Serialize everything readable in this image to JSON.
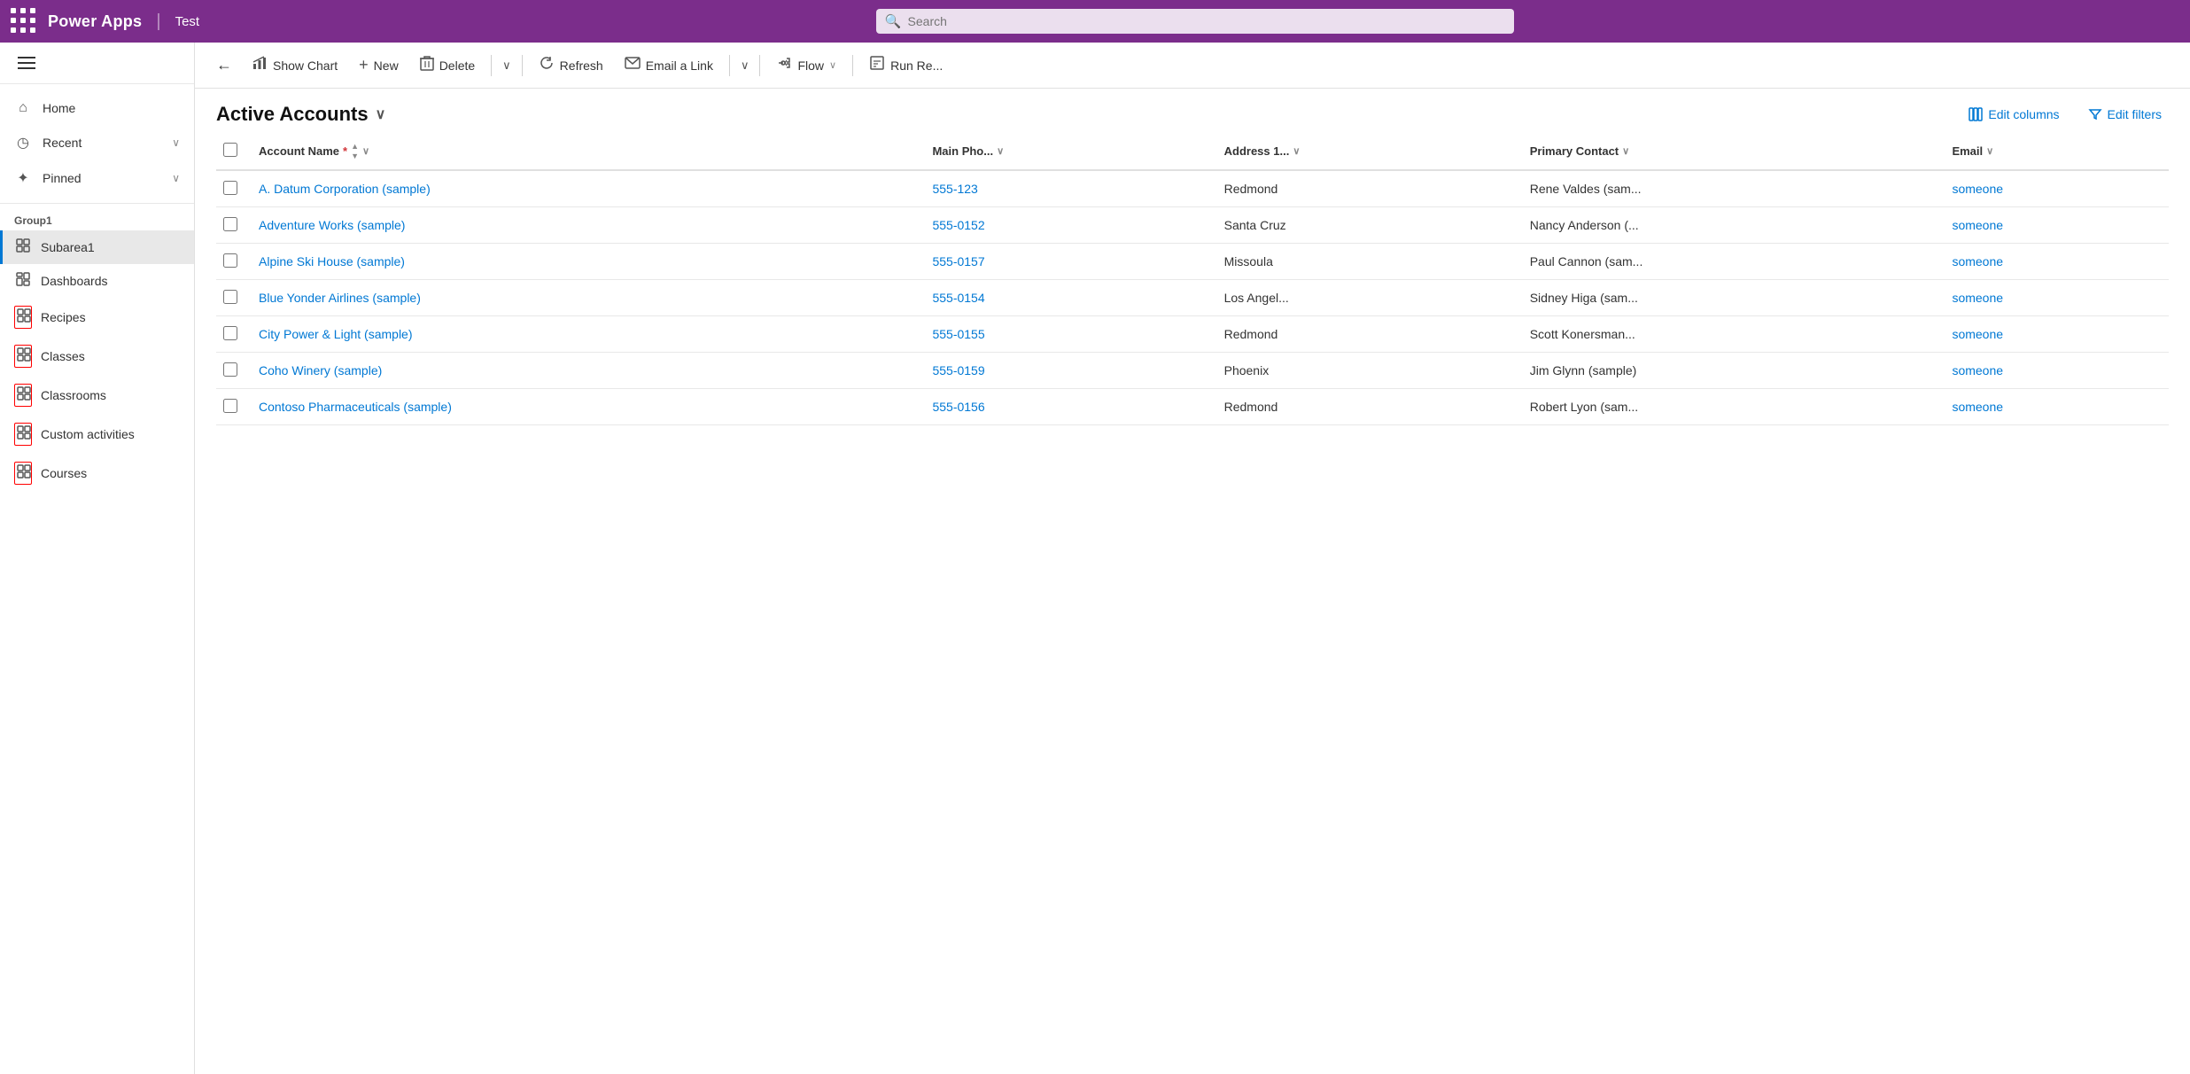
{
  "topnav": {
    "brand": "Power Apps",
    "divider": "|",
    "app": "Test",
    "search_placeholder": "Search"
  },
  "sidebar": {
    "nav_items": [
      {
        "id": "home",
        "label": "Home",
        "icon": "⌂",
        "has_chevron": false
      },
      {
        "id": "recent",
        "label": "Recent",
        "icon": "⊙",
        "has_chevron": true
      },
      {
        "id": "pinned",
        "label": "Pinned",
        "icon": "✦",
        "has_chevron": true
      }
    ],
    "group_label": "Group1",
    "items": [
      {
        "id": "subarea1",
        "label": "Subarea1",
        "icon": "⊞",
        "active": true,
        "outlined": false
      },
      {
        "id": "dashboards",
        "label": "Dashboards",
        "icon": "⊞",
        "active": false,
        "outlined": false
      },
      {
        "id": "recipes",
        "label": "Recipes",
        "icon": "⊞",
        "active": false,
        "outlined": true
      },
      {
        "id": "classes",
        "label": "Classes",
        "icon": "⊞",
        "active": false,
        "outlined": true
      },
      {
        "id": "classrooms",
        "label": "Classrooms",
        "icon": "⊞",
        "active": false,
        "outlined": true
      },
      {
        "id": "custom-activities",
        "label": "Custom activities",
        "icon": "⊞",
        "active": false,
        "outlined": true
      },
      {
        "id": "courses",
        "label": "Courses",
        "icon": "⊞",
        "active": false,
        "outlined": true
      }
    ]
  },
  "toolbar": {
    "back_label": "←",
    "show_chart_label": "Show Chart",
    "new_label": "New",
    "delete_label": "Delete",
    "refresh_label": "Refresh",
    "email_a_link_label": "Email a Link",
    "flow_label": "Flow",
    "run_report_label": "Run Re..."
  },
  "list": {
    "title": "Active Accounts",
    "edit_columns_label": "Edit columns",
    "edit_filters_label": "Edit filters"
  },
  "table": {
    "columns": [
      {
        "id": "account-name",
        "label": "Account Name",
        "required": true,
        "sortable": true
      },
      {
        "id": "main-phone",
        "label": "Main Pho...",
        "sortable": true
      },
      {
        "id": "address1",
        "label": "Address 1...",
        "sortable": true
      },
      {
        "id": "primary-contact",
        "label": "Primary Contact",
        "sortable": true
      },
      {
        "id": "email",
        "label": "Email",
        "sortable": true
      }
    ],
    "rows": [
      {
        "account_name": "A. Datum Corporation (sample)",
        "main_phone": "555-123",
        "address1": "Redmond",
        "primary_contact": "Rene Valdes (sam...",
        "email": "someone"
      },
      {
        "account_name": "Adventure Works (sample)",
        "main_phone": "555-0152",
        "address1": "Santa Cruz",
        "primary_contact": "Nancy Anderson (...",
        "email": "someone"
      },
      {
        "account_name": "Alpine Ski House (sample)",
        "main_phone": "555-0157",
        "address1": "Missoula",
        "primary_contact": "Paul Cannon (sam...",
        "email": "someone"
      },
      {
        "account_name": "Blue Yonder Airlines (sample)",
        "main_phone": "555-0154",
        "address1": "Los Angel...",
        "primary_contact": "Sidney Higa (sam...",
        "email": "someone"
      },
      {
        "account_name": "City Power & Light (sample)",
        "main_phone": "555-0155",
        "address1": "Redmond",
        "primary_contact": "Scott Konersman...",
        "email": "someone"
      },
      {
        "account_name": "Coho Winery (sample)",
        "main_phone": "555-0159",
        "address1": "Phoenix",
        "primary_contact": "Jim Glynn (sample)",
        "email": "someone"
      },
      {
        "account_name": "Contoso Pharmaceuticals (sample)",
        "main_phone": "555-0156",
        "address1": "Redmond",
        "primary_contact": "Robert Lyon (sam...",
        "email": "someone"
      }
    ]
  }
}
